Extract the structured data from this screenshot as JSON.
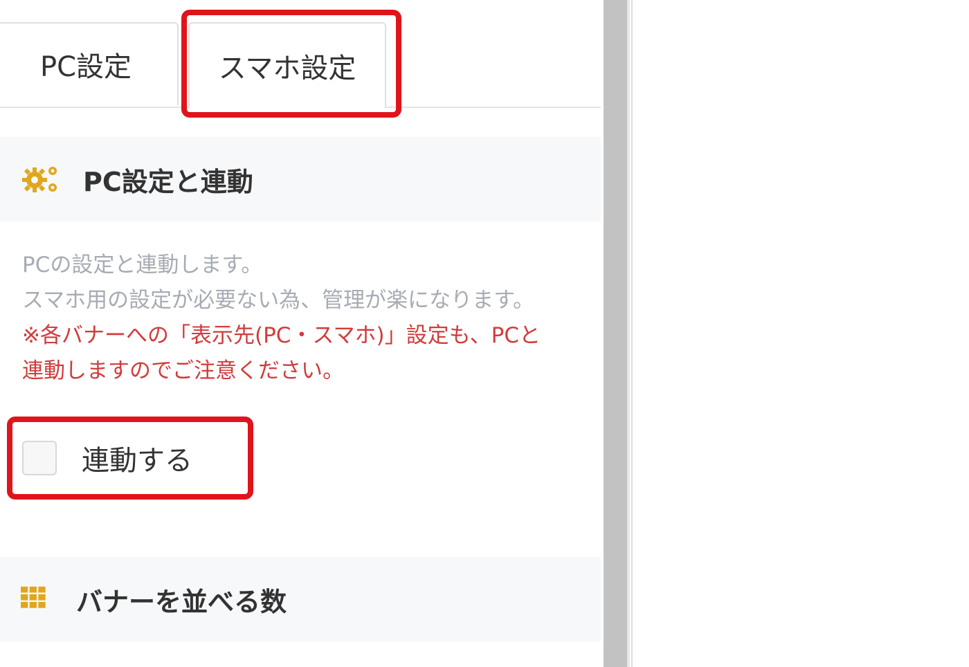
{
  "tabs": [
    {
      "label": "PC設定",
      "active": false
    },
    {
      "label": "スマホ設定",
      "active": true
    }
  ],
  "sync_section": {
    "title": "PC設定と連動",
    "icon": "gears-icon",
    "description_lines": [
      "PCの設定と連動します。",
      "スマホ用の設定が必要ない為、管理が楽になります。"
    ],
    "warning_lines": [
      "※各バナーへの「表示先(PC・スマホ)」設定も、PCと",
      "連動しますのでご注意ください。"
    ],
    "checkbox_label": "連動する",
    "checkbox_checked": false
  },
  "banner_section": {
    "title": "バナーを並べる数",
    "icon": "grid-icon"
  },
  "colors": {
    "accent_icon": "#e0a71e",
    "highlight": "#e0141b",
    "warning_text": "#d23b3b",
    "muted_text": "#a7abb3"
  }
}
